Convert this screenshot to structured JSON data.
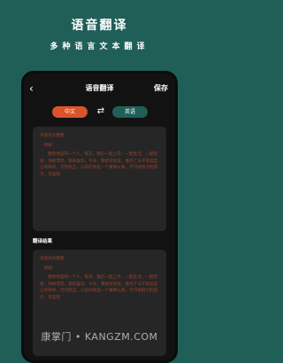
{
  "promo": {
    "title": "语音翻译",
    "subtitle": "多种语言文本翻译"
  },
  "nav": {
    "back_icon": "chevron-left-icon",
    "title": "语音翻译",
    "save_label": "保存"
  },
  "languages": {
    "source": "中文",
    "swap_icon": "swap-arrows-icon",
    "target": "英语"
  },
  "input_card": {
    "title": "亲爱的大猩猩",
    "greeting": "你好：",
    "body": "我和你是同一个人。每天，我们一起上学，一起生活，一起玩耍。你很漂亮。我很喜欢。今天，我想对你说，谁作了以干就读自己的缺点，可惜找正。以前的你是一个做事认真，学习很努力的孩子，可是现"
  },
  "result_label": "翻译结果",
  "output_card": {
    "title": "亲爱的大猩猩",
    "greeting": "你好：",
    "body": "我和你是同一个人。每天，我们一起上学，一起生活，一起玩耍。你很漂亮。我很喜欢。今天，我想对你说，谁作了以干就读自己的缺点，可惜找正。以前的你是一个做事认真，学习很努力的孩子，可是现"
  },
  "watermark": "康掌门 • KANGZM.COM",
  "colors": {
    "background": "#1f5f58",
    "phone": "#121212",
    "card": "#262626",
    "accent_orange": "#d9532b",
    "text_red": "#a2432a"
  }
}
